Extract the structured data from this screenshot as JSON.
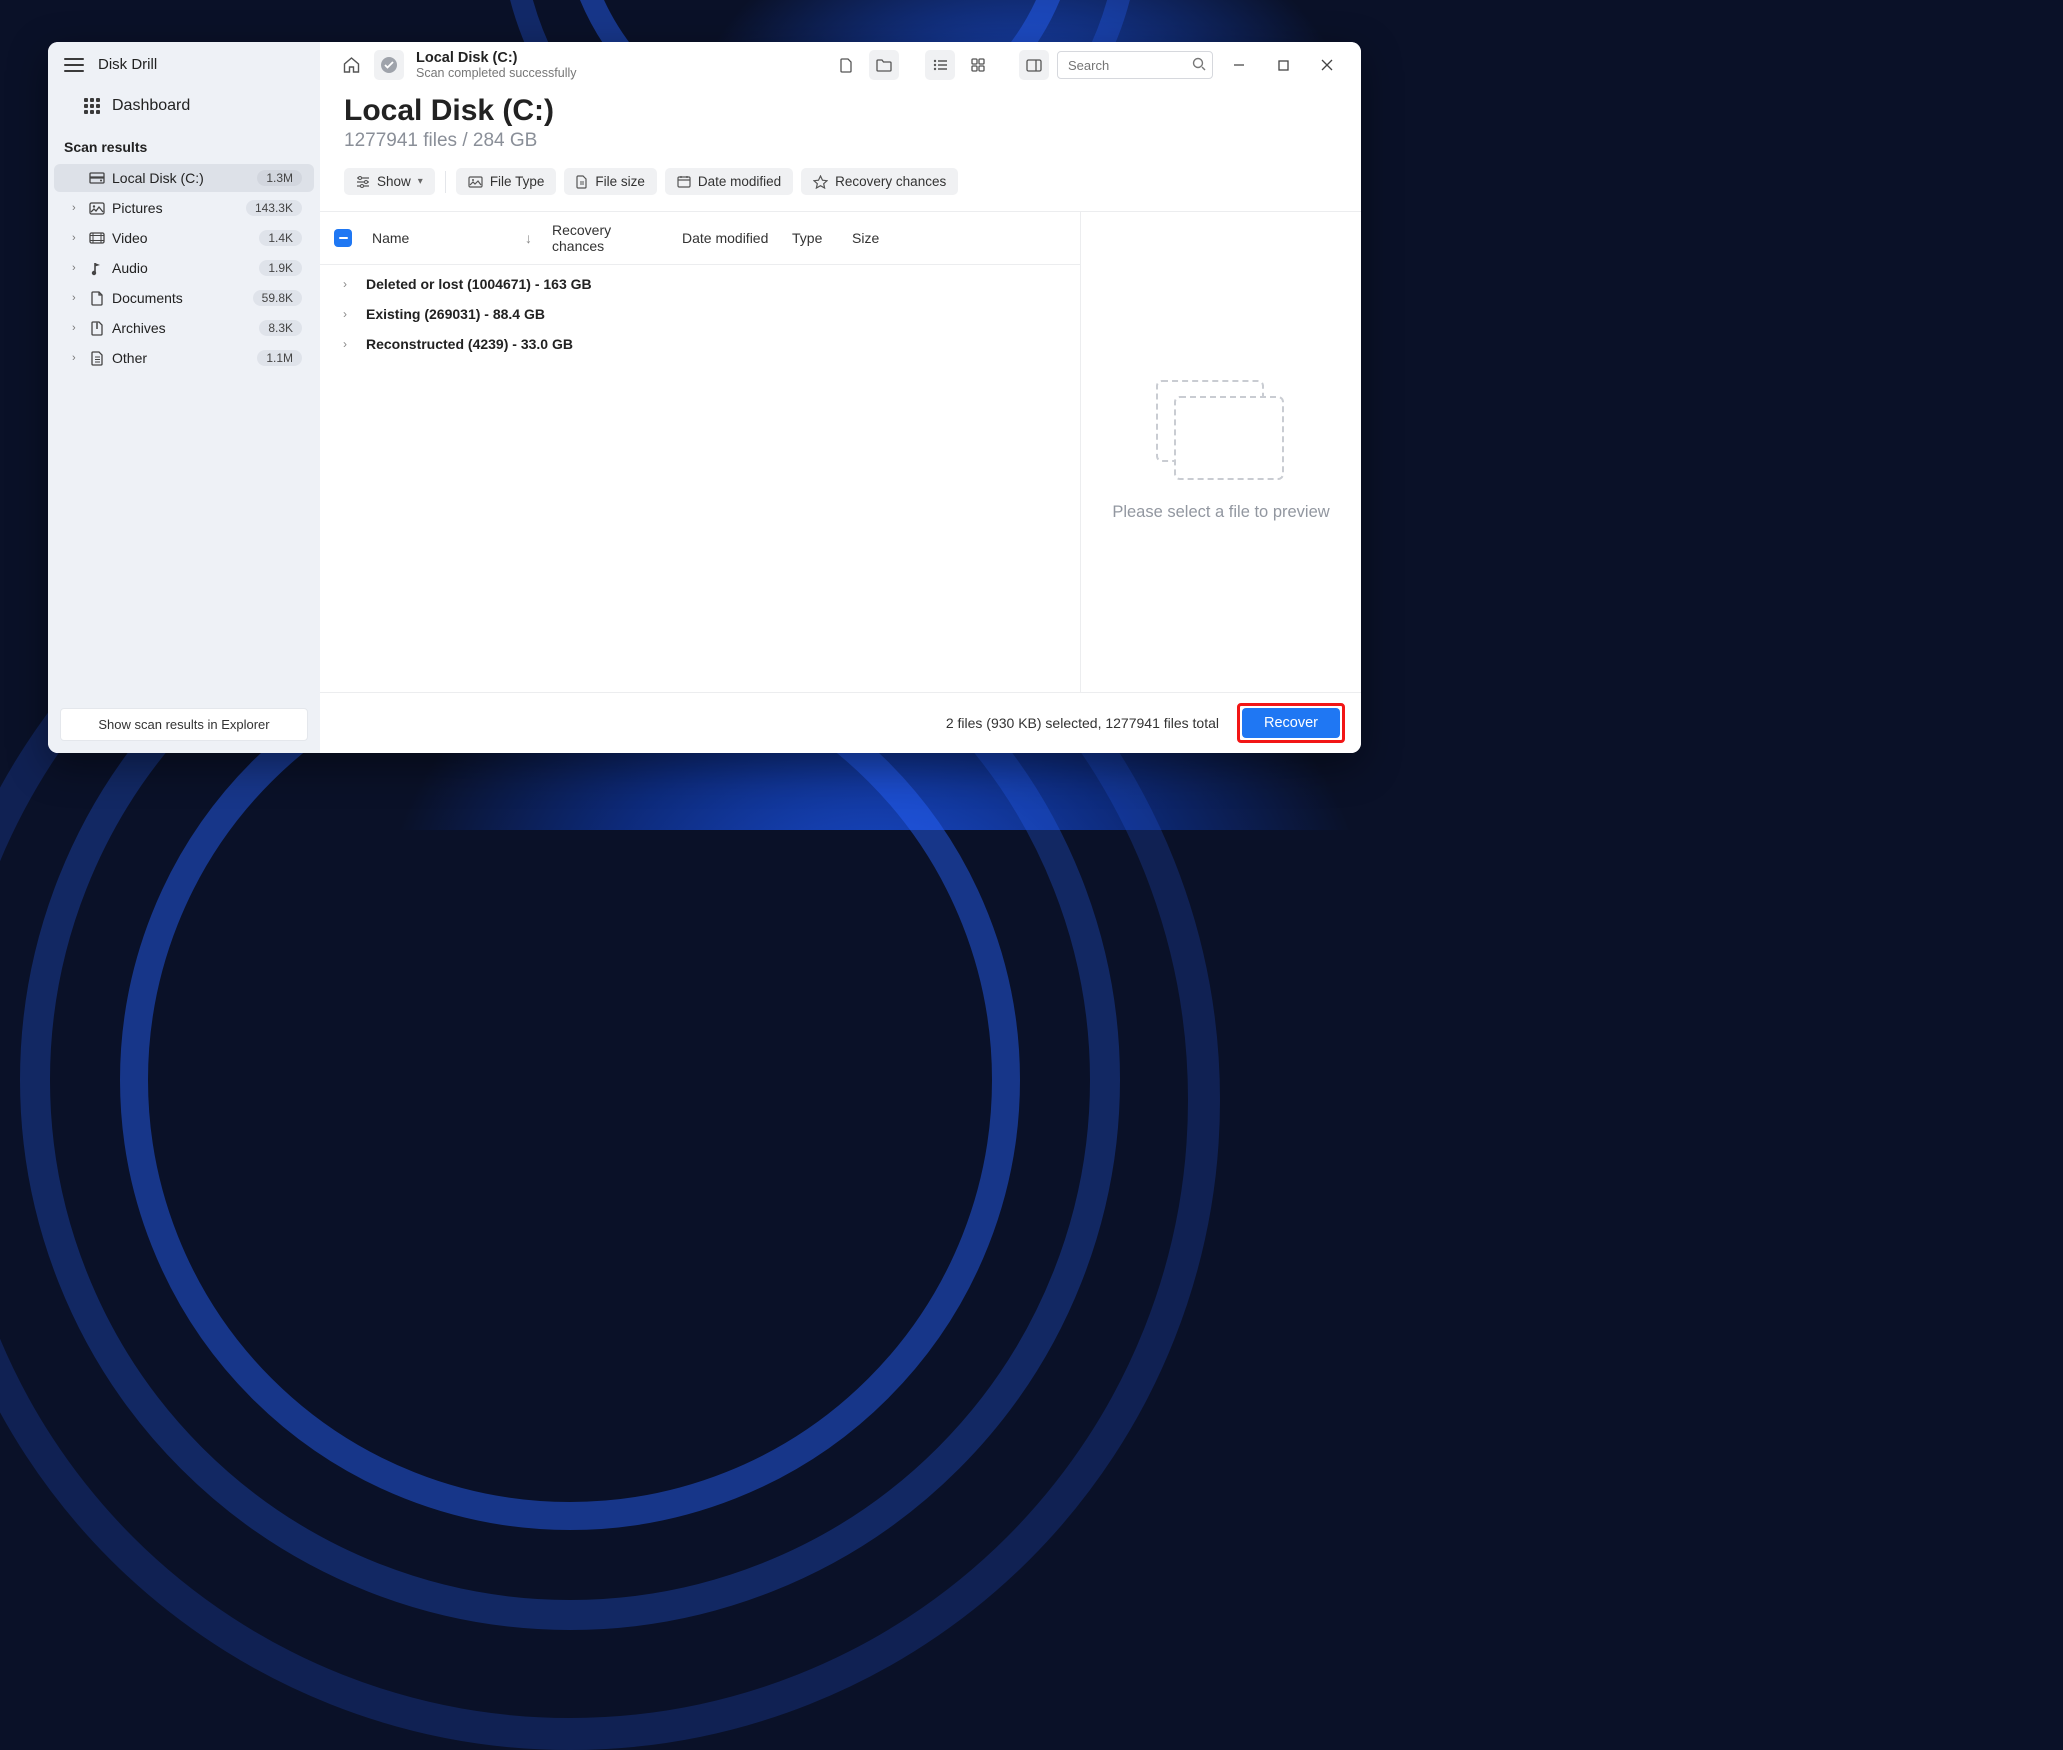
{
  "brand": {
    "title": "Disk Drill"
  },
  "sidebar": {
    "dashboard": "Dashboard",
    "scan_results": "Scan results",
    "items": [
      {
        "label": "Local Disk (C:)",
        "count": "1.3M",
        "selected": true,
        "expandable": false,
        "icon": "disk"
      },
      {
        "label": "Pictures",
        "count": "143.3K",
        "selected": false,
        "expandable": true,
        "icon": "image"
      },
      {
        "label": "Video",
        "count": "1.4K",
        "selected": false,
        "expandable": true,
        "icon": "video"
      },
      {
        "label": "Audio",
        "count": "1.9K",
        "selected": false,
        "expandable": true,
        "icon": "audio"
      },
      {
        "label": "Documents",
        "count": "59.8K",
        "selected": false,
        "expandable": true,
        "icon": "doc"
      },
      {
        "label": "Archives",
        "count": "8.3K",
        "selected": false,
        "expandable": true,
        "icon": "archive"
      },
      {
        "label": "Other",
        "count": "1.1M",
        "selected": false,
        "expandable": true,
        "icon": "other"
      }
    ],
    "explorer_btn": "Show scan results in Explorer"
  },
  "breadcrumb": {
    "title": "Local Disk (C:)",
    "sub": "Scan completed successfully"
  },
  "search": {
    "placeholder": "Search"
  },
  "title": {
    "main": "Local Disk (C:)",
    "sub": "1277941 files / 284 GB"
  },
  "filters": {
    "show": "Show",
    "file_type": "File Type",
    "file_size": "File size",
    "date_modified": "Date modified",
    "recovery_chances": "Recovery chances"
  },
  "table": {
    "headers": {
      "name": "Name",
      "recovery": "Recovery chances",
      "date": "Date modified",
      "type": "Type",
      "size": "Size"
    },
    "rows": [
      {
        "label": "Deleted or lost (1004671) - 163 GB"
      },
      {
        "label": "Existing (269031) - 88.4 GB"
      },
      {
        "label": "Reconstructed (4239) - 33.0 GB"
      }
    ]
  },
  "preview": {
    "text": "Please select a file to preview"
  },
  "status": {
    "text": "2 files (930 KB) selected, 1277941 files total",
    "recover": "Recover"
  }
}
